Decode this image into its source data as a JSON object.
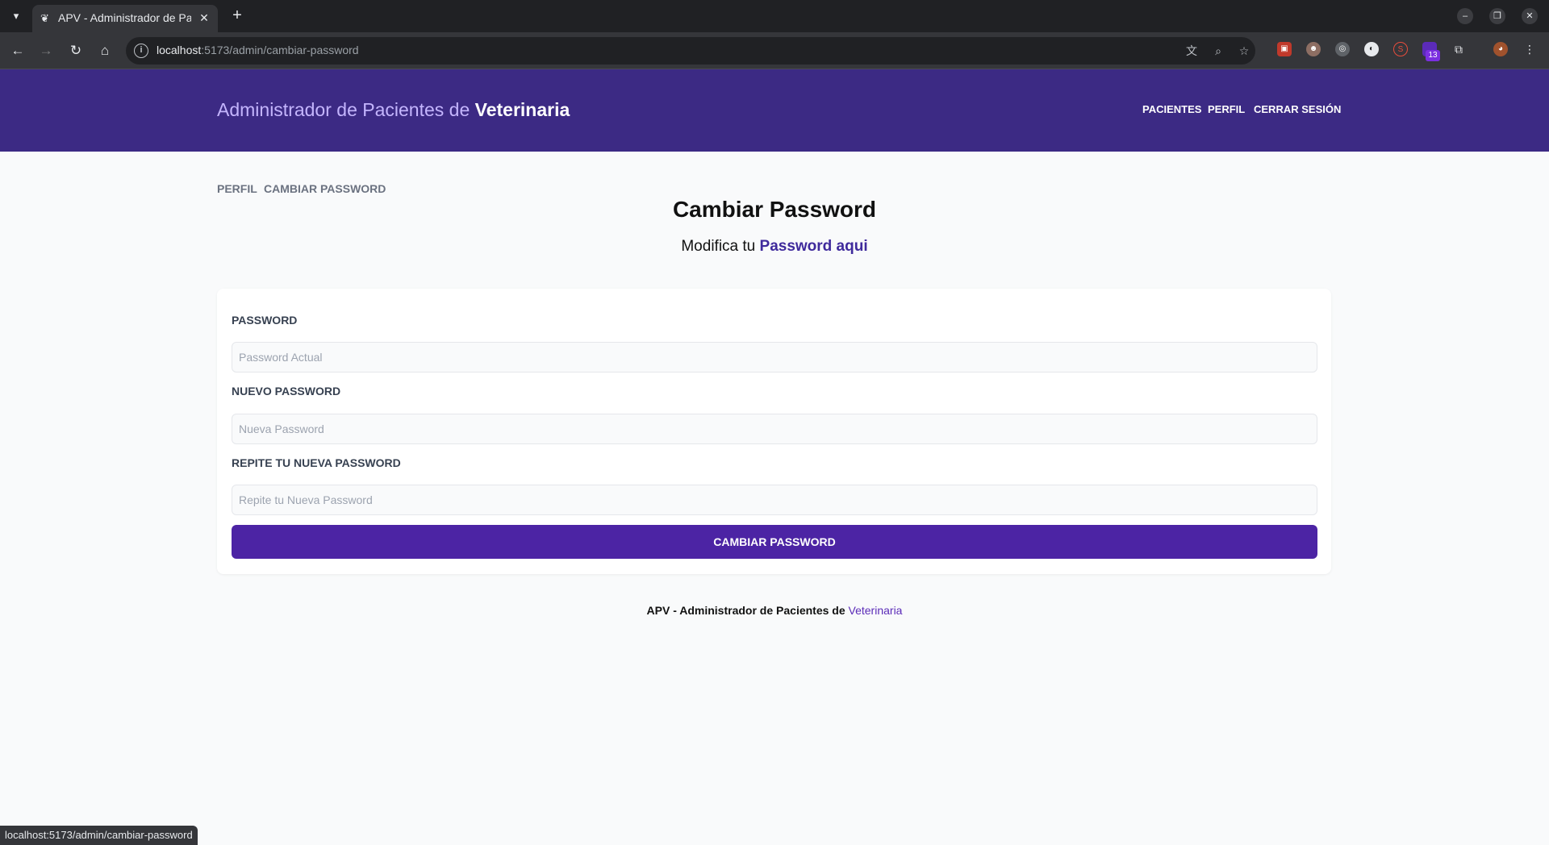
{
  "browser": {
    "tab_title": "APV - Administrador de Pacientes de Veterinaria",
    "url_host": "localhost",
    "url_path": ":5173/admin/cambiar-password",
    "extension_badge": "13",
    "status_text": "localhost:5173/admin/cambiar-password"
  },
  "header": {
    "brand_prefix": "Administrador de Pacientes de",
    "brand_bold": "Veterinaria",
    "nav": {
      "pacientes": "Pacientes",
      "perfil": "Perfil",
      "cerrar_sesion": "Cerrar Sesión"
    }
  },
  "sidebar": {
    "perfil": "Perfil",
    "cambiar_password": "Cambiar Password"
  },
  "main": {
    "title": "Cambiar Password",
    "subtitle_prefix": "Modifica tu",
    "subtitle_highlight": "Password aqui"
  },
  "form": {
    "current": {
      "label": "Password",
      "placeholder": "Password Actual",
      "value": ""
    },
    "new": {
      "label": "Nuevo Password",
      "placeholder": "Nueva Password",
      "value": ""
    },
    "repeat": {
      "label": "Repite tu Nueva Password",
      "placeholder": "Repite tu Nueva Password",
      "value": ""
    },
    "submit_label": "Cambiar Password"
  },
  "footer": {
    "prefix": "APV - Administrador de Pacientes de",
    "highlight": "Veterinaria"
  },
  "colors": {
    "header_bg": "#3c2a84",
    "button_bg": "#4c24a4",
    "accent": "#5b2bb8"
  }
}
